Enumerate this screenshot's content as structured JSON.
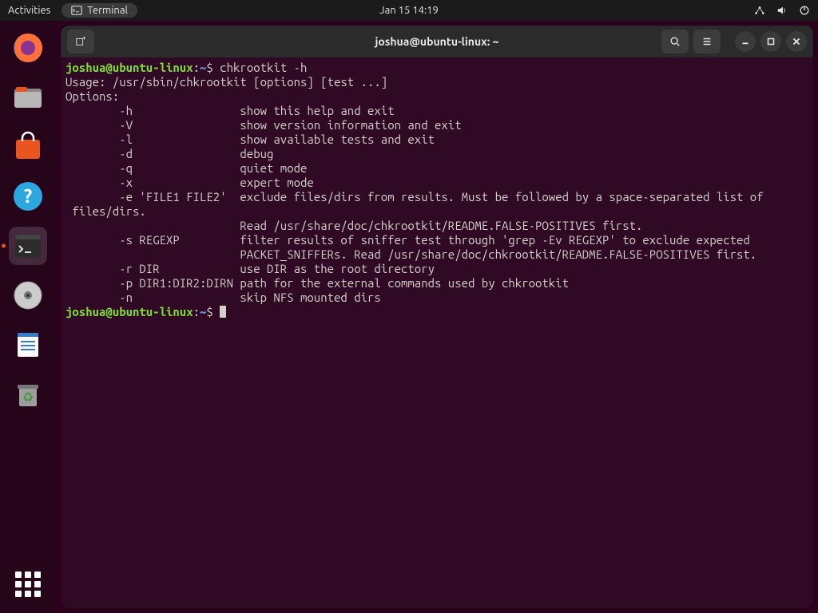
{
  "topbar": {
    "activities": "Activities",
    "app_label": "Terminal",
    "clock": "Jan 15  14:19"
  },
  "dock": {
    "items": [
      {
        "name": "firefox"
      },
      {
        "name": "files"
      },
      {
        "name": "software"
      },
      {
        "name": "help"
      },
      {
        "name": "terminal"
      },
      {
        "name": "disc"
      },
      {
        "name": "text-editor"
      },
      {
        "name": "trash"
      }
    ]
  },
  "window": {
    "title": "joshua@ubuntu-linux: ~"
  },
  "prompt": {
    "user_host": "joshua@ubuntu-linux",
    "path": "~",
    "dollar": "$"
  },
  "term": {
    "cmd1": "chkrootkit -h",
    "lines": [
      "Usage: /usr/sbin/chkrootkit [options] [test ...]",
      "Options:",
      "        -h                show this help and exit",
      "        -V                show version information and exit",
      "        -l                show available tests and exit",
      "        -d                debug",
      "        -q                quiet mode",
      "        -x                expert mode",
      "        -e 'FILE1 FILE2'  exclude files/dirs from results. Must be followed by a space-separated list of",
      " files/dirs.",
      "                          Read /usr/share/doc/chkrootkit/README.FALSE-POSITIVES first.",
      "        -s REGEXP         filter results of sniffer test through 'grep -Ev REGEXP' to exclude expected",
      "                          PACKET_SNIFFERs. Read /usr/share/doc/chkrootkit/README.FALSE-POSITIVES first.",
      "        -r DIR            use DIR as the root directory",
      "        -p DIR1:DIR2:DIRN path for the external commands used by chkrootkit",
      "        -n                skip NFS mounted dirs"
    ]
  }
}
